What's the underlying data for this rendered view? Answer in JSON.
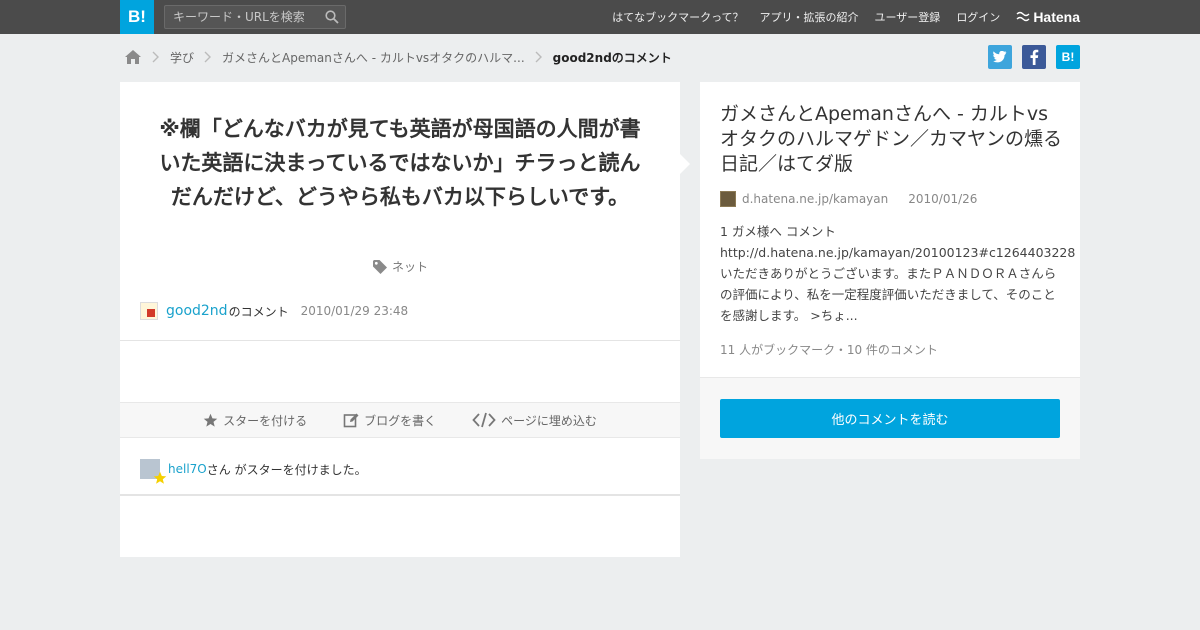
{
  "header": {
    "logo": "B!",
    "search_placeholder": "キーワード・URLを検索",
    "nav": [
      "はてなブックマークって？",
      "アプリ・拡張の紹介",
      "ユーザー登録",
      "ログイン"
    ],
    "brand": "Hatena"
  },
  "breadcrumb": {
    "items": [
      "学び",
      "ガメさんとApemanさんへ - カルトvsオタクのハルマ...",
      "good2ndのコメント"
    ]
  },
  "share": {
    "hatena": "B!"
  },
  "comment": {
    "text": "※欄「どんなバカが見ても英語が母国語の人間が書いた英語に決まっているではないか」チラっと読んだんだけど、どうやら私もバカ以下らしいです。",
    "tag": "ネット",
    "user": "good2nd",
    "user_suffix": "のコメント",
    "date": "2010/01/29 23:48"
  },
  "actions": {
    "star": "スターを付ける",
    "blog": "ブログを書く",
    "embed": "ページに埋め込む"
  },
  "star_notice": {
    "user": "hell7O",
    "text": "さん がスターを付けました。"
  },
  "entry": {
    "title": "ガメさんとApemanさんへ - カルトvsオタクのハルマゲドン／カマヤンの燻る日記／はてダ版",
    "domain": "d.hatena.ne.jp/kamayan",
    "date": "2010/01/26",
    "summary": "1 ガメ様へ コメント http://d.hatena.ne.jp/kamayan/20100123#c1264403228いただきありがとうございます。またＰＡＮＤＯＲＡさんらの評価により、私を一定程度評価いただきまして、そのことを感謝します。 >ちょ...",
    "stats": "11 人がブックマーク・10 件のコメント",
    "more_button": "他のコメントを読む"
  },
  "colors": {
    "brand_blue": "#00a4de",
    "header_bg": "#4b4b4b",
    "link": "#1aa2cc",
    "page_bg": "#eceeef"
  }
}
